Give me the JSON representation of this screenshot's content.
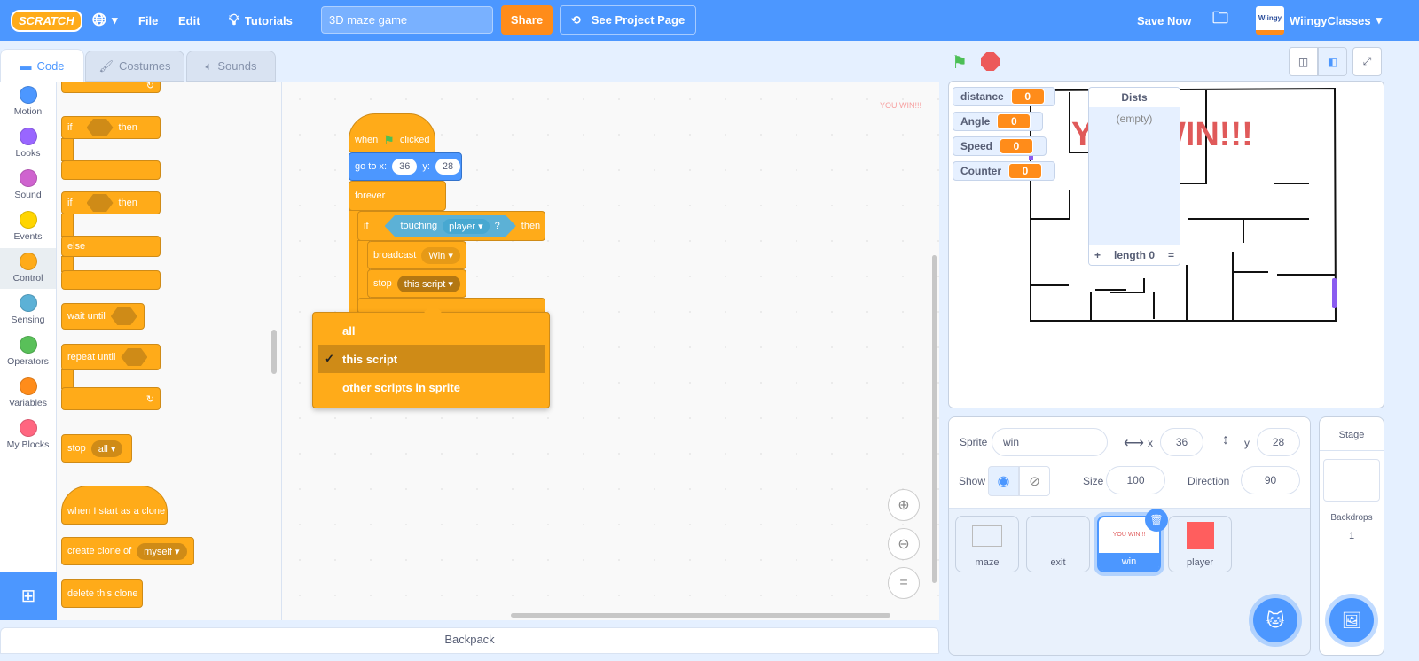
{
  "menubar": {
    "logo": "SCRATCH",
    "file": "File",
    "edit": "Edit",
    "tutorials": "Tutorials",
    "project_title": "3D maze game",
    "share": "Share",
    "see_project": "See Project Page",
    "save_now": "Save Now",
    "username": "WiingyClasses",
    "avatar_text": "Wiingy"
  },
  "tabs": {
    "code": "Code",
    "costumes": "Costumes",
    "sounds": "Sounds"
  },
  "categories": [
    {
      "label": "Motion",
      "color": "#4c97ff"
    },
    {
      "label": "Looks",
      "color": "#9966ff"
    },
    {
      "label": "Sound",
      "color": "#cf63cf"
    },
    {
      "label": "Events",
      "color": "#ffd500"
    },
    {
      "label": "Control",
      "color": "#ffab19"
    },
    {
      "label": "Sensing",
      "color": "#5cb1d6"
    },
    {
      "label": "Operators",
      "color": "#59c059"
    },
    {
      "label": "Variables",
      "color": "#ff8c1a"
    },
    {
      "label": "My Blocks",
      "color": "#ff6680"
    }
  ],
  "palette": {
    "if1": "if",
    "then1": "then",
    "if2": "if",
    "then2": "then",
    "else": "else",
    "wait_until": "wait until",
    "repeat_until": "repeat until",
    "stop": "stop",
    "stop_opt": "all",
    "clone_hat": "when I start as a clone",
    "create_clone": "create clone of",
    "clone_opt": "myself",
    "delete_clone": "delete this clone"
  },
  "script": {
    "when": "when",
    "clicked": "clicked",
    "goto": "go to x:",
    "x": "36",
    "y_label": "y:",
    "y": "28",
    "forever": "forever",
    "if": "if",
    "touching": "touching",
    "touch_opt": "player",
    "q": "?",
    "then": "then",
    "broadcast": "broadcast",
    "msg": "Win",
    "stop": "stop",
    "stop_opt": "this script"
  },
  "dropdown": {
    "items": [
      {
        "label": "all",
        "selected": false
      },
      {
        "label": "this script",
        "selected": true
      },
      {
        "label": "other scripts in sprite",
        "selected": false
      }
    ],
    "check": "✓"
  },
  "watermark": "YOU WIN!!!",
  "backpack": "Backpack",
  "monitors": [
    {
      "name": "distance",
      "value": "0"
    },
    {
      "name": "Angle",
      "value": "0"
    },
    {
      "name": "Speed",
      "value": "0"
    },
    {
      "name": "Counter",
      "value": "0"
    }
  ],
  "list": {
    "title": "Dists",
    "empty": "(empty)",
    "plus": "+",
    "length": "length 0",
    "eq": "="
  },
  "stage_text": "YOU WIN!!!",
  "sprite_info": {
    "sprite_label": "Sprite",
    "name": "win",
    "x_label": "x",
    "x": "36",
    "y_label": "y",
    "y": "28",
    "show_label": "Show",
    "size_label": "Size",
    "size": "100",
    "direction_label": "Direction",
    "direction": "90"
  },
  "sprites": [
    {
      "name": "maze",
      "selected": false
    },
    {
      "name": "exit",
      "selected": false
    },
    {
      "name": "win",
      "selected": true,
      "thumb": "YOU WIN!!!"
    },
    {
      "name": "player",
      "selected": false
    }
  ],
  "stage_panel": {
    "title": "Stage",
    "backdrops_label": "Backdrops",
    "backdrops": "1"
  },
  "colors": {
    "accent": "#4c97ff",
    "control": "#ffab19",
    "share": "#ff8c1a"
  }
}
